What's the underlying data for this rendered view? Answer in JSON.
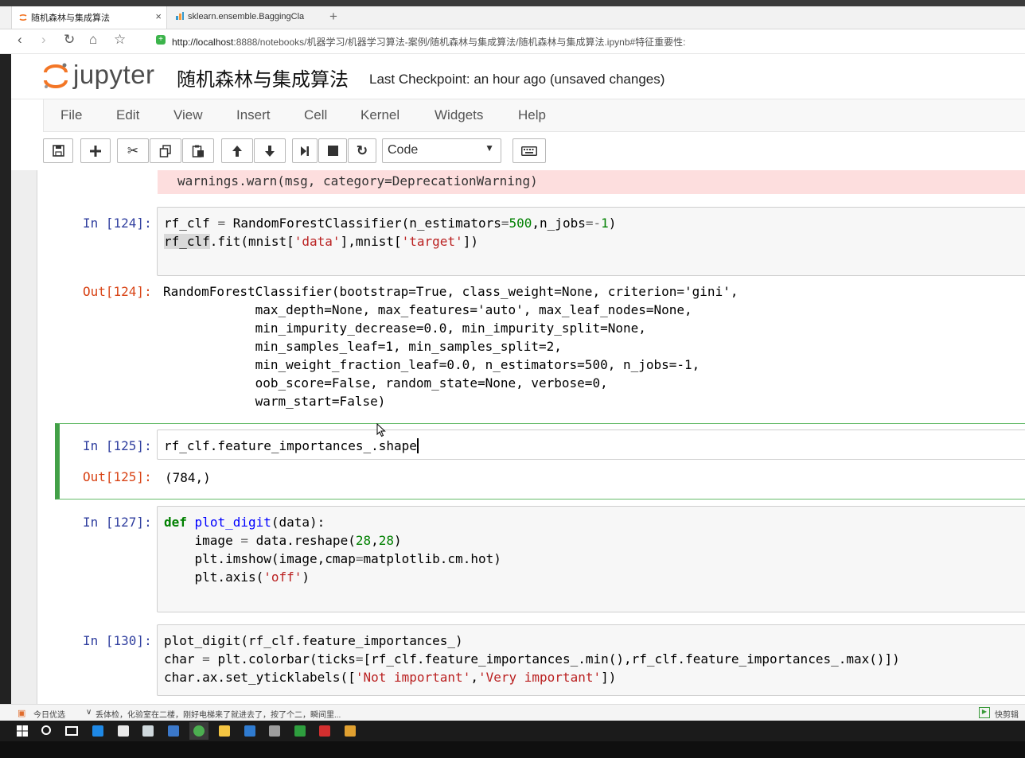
{
  "browser": {
    "tabs": [
      {
        "title": "随机森林与集成算法"
      },
      {
        "title": "sklearn.ensemble.BaggingCla"
      }
    ],
    "new_tab": "+",
    "close": "×",
    "url_host": "http://localhost",
    "url_rest": ":8888/notebooks/机器学习/机器学习算法-案例/随机森林与集成算法/随机森林与集成算法.ipynb#特征重要性:"
  },
  "jupyter": {
    "logo_text": "jupyter",
    "notebook_title": "随机森林与集成算法",
    "checkpoint": "Last Checkpoint: an hour ago (unsaved changes)",
    "menu": [
      "File",
      "Edit",
      "View",
      "Insert",
      "Cell",
      "Kernel",
      "Widgets",
      "Help"
    ],
    "cell_type": "Code"
  },
  "cells": {
    "warning_tail": "warnings.warn(msg, category=DeprecationWarning)",
    "c124_in_prompt": "In [124]:",
    "c124_out_prompt": "Out[124]:",
    "c125_in_prompt": "In [125]:",
    "c125_out_prompt": "Out[125]:",
    "c125_code": "rf_clf.feature_importances_.shape",
    "c125_output": "(784,)",
    "c127_in_prompt": "In [127]:",
    "c130_in_prompt": "In [130]:"
  },
  "status": {
    "left_label": "今日优选",
    "news": "丢体检，化验室在二楼，刚好电梯来了就进去了，按了个二，瞬间里...",
    "right_label": "快剪辑"
  },
  "colors": {
    "in_prompt": "#303f9f",
    "out_prompt": "#d84315",
    "selected_border": "#42a047",
    "error_bg": "#fddede"
  }
}
